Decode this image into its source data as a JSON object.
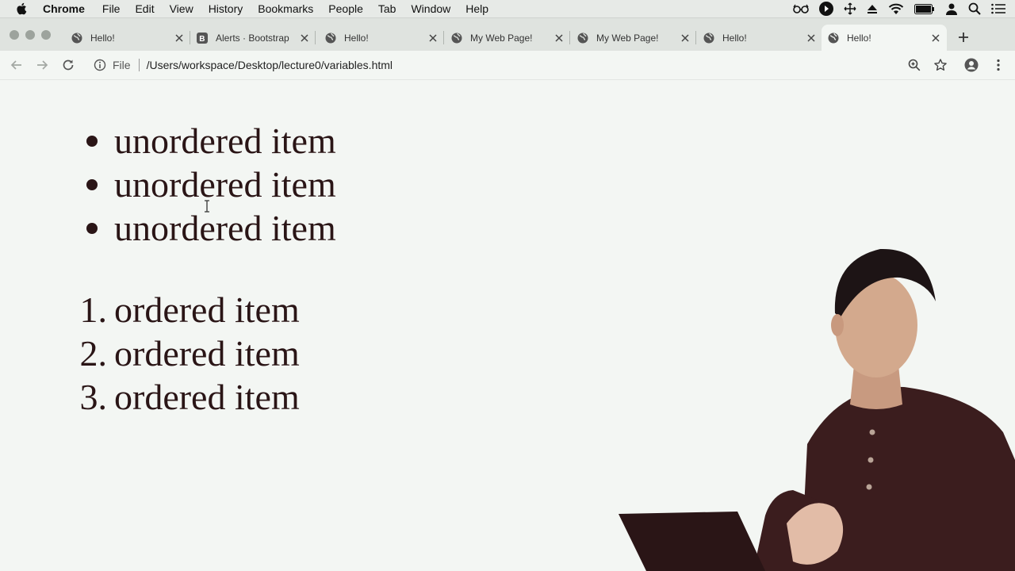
{
  "menubar": {
    "app_name": "Chrome",
    "items": [
      "File",
      "Edit",
      "View",
      "History",
      "Bookmarks",
      "People",
      "Tab",
      "Window",
      "Help"
    ],
    "status_icons": [
      "glasses-icon",
      "play-circle-icon",
      "move-icon",
      "eject-icon",
      "wifi-icon",
      "battery-icon",
      "user-icon",
      "search-icon",
      "list-icon"
    ]
  },
  "tabs": [
    {
      "title": "Hello!",
      "favicon": "globe-icon",
      "active": false
    },
    {
      "title": "Alerts · Bootstrap",
      "favicon": "bootstrap-icon",
      "active": false
    },
    {
      "title": "Hello!",
      "favicon": "globe-icon",
      "active": false
    },
    {
      "title": "My Web Page!",
      "favicon": "globe-icon",
      "active": false
    },
    {
      "title": "My Web Page!",
      "favicon": "globe-icon",
      "active": false
    },
    {
      "title": "Hello!",
      "favicon": "globe-icon",
      "active": false
    },
    {
      "title": "Hello!",
      "favicon": "globe-icon",
      "active": true
    }
  ],
  "toolbar": {
    "scheme_label": "File",
    "url": "/Users/workspace/Desktop/lecture0/variables.html"
  },
  "page": {
    "unordered_items": [
      "unordered item",
      "unordered item",
      "unordered item"
    ],
    "ordered_items": [
      "ordered item",
      "ordered item",
      "ordered item"
    ],
    "ordered_markers": [
      "1.",
      "2.",
      "3."
    ]
  },
  "colors": {
    "page_background": "#f3f6f3",
    "text": "#2a1516",
    "chrome_frame": "#dfe3df"
  }
}
